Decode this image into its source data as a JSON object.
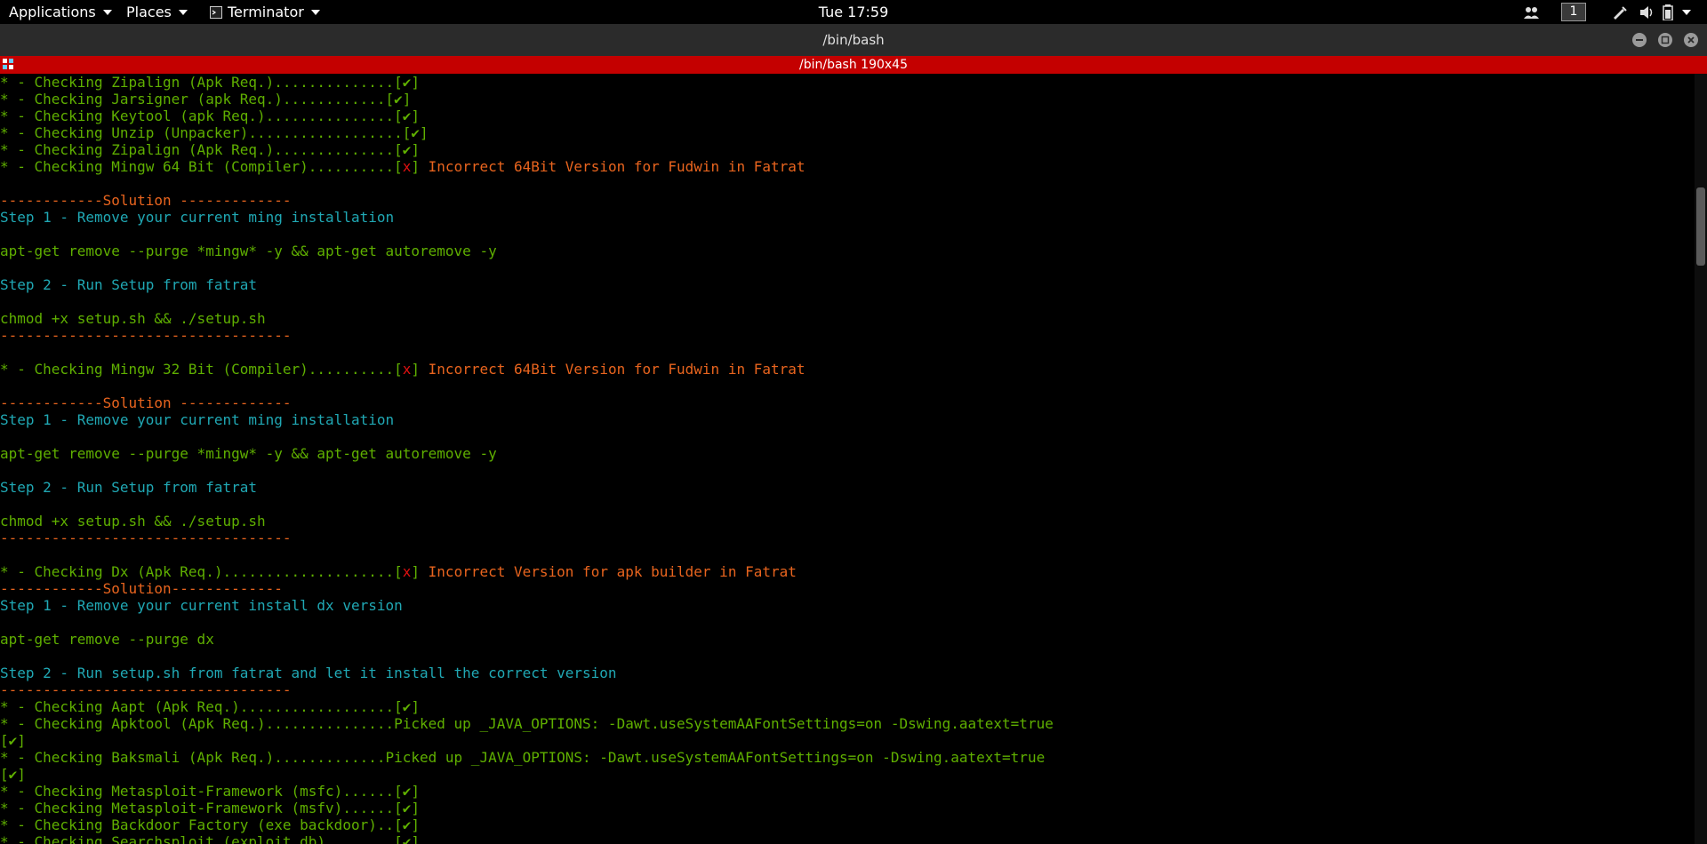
{
  "panel": {
    "applications": "Applications",
    "places": "Places",
    "terminator": "Terminator",
    "clock": "Tue 17:59",
    "workspace": "1"
  },
  "window": {
    "title": "/bin/bash",
    "tab_title": "/bin/bash 190x45"
  },
  "terminal": {
    "l01": "* - Checking Jarsigner (apk Req.)............[",
    "l02": "* - Checking Keytool (apk Req.)...............[",
    "l03": "* - Checking Unzip (Unpacker)..................[",
    "l04": "* - Checking Zipalign (Apk Req.)..............[",
    "l05": "* - Checking Mingw 64 Bit (Compiler)..........[",
    "check": "✔",
    "cross": "x",
    "close_br": "]",
    "incorrect64": " Incorrect 64Bit Version for Fudwin in Fatrat",
    "sol_dash": "------------",
    "solution": "Solution",
    "sol_dash_end": " -------------",
    "sol2_end": "-------------",
    "step1_ming": "Step 1 - Remove your current ming installation",
    "cmd_remove_mingw": "apt-get remove --purge *mingw* -y && apt-get autoremove -y",
    "step2_setup": "Step 2 - Run Setup from fatrat",
    "cmd_setup": "chmod +x setup.sh && ./setup.sh",
    "separator": "----------------------------------",
    "l_mingw32": "* - Checking Mingw 32 Bit (Compiler)..........[",
    "l_dx": "* - Checking Dx (Apk Req.)....................[",
    "incorrect_dx": " Incorrect Version for apk builder in Fatrat",
    "step1_dx": "Step 1 - Remove your current install dx version",
    "cmd_remove_dx": "apt-get remove --purge dx",
    "step2_dx": "Step 2 - Run setup.sh from fatrat and let it install the correct version",
    "l_aapt": "* - Checking Aapt (Apk Req.)..................[",
    "l_apktool": "* - Checking Apktool (Apk Req.)...............Picked up _JAVA_OPTIONS: -Dawt.useSystemAAFontSettings=on -Dswing.aatext=true",
    "l_baksmali": "* - Checking Baksmali (Apk Req.).............Picked up _JAVA_OPTIONS: -Dawt.useSystemAAFontSettings=on -Dswing.aatext=true",
    "check_alone": "[✔]",
    "l_msfc": "* - Checking Metasploit-Framework (msfc)......[",
    "l_msfv": "* - Checking Metasploit-Framework (msfv)......[",
    "l_bdf": "* - Checking Backdoor Factory (exe backdoor)..[",
    "l_searchsploit": "* - Checking Searchsploit (exploit db)........["
  }
}
